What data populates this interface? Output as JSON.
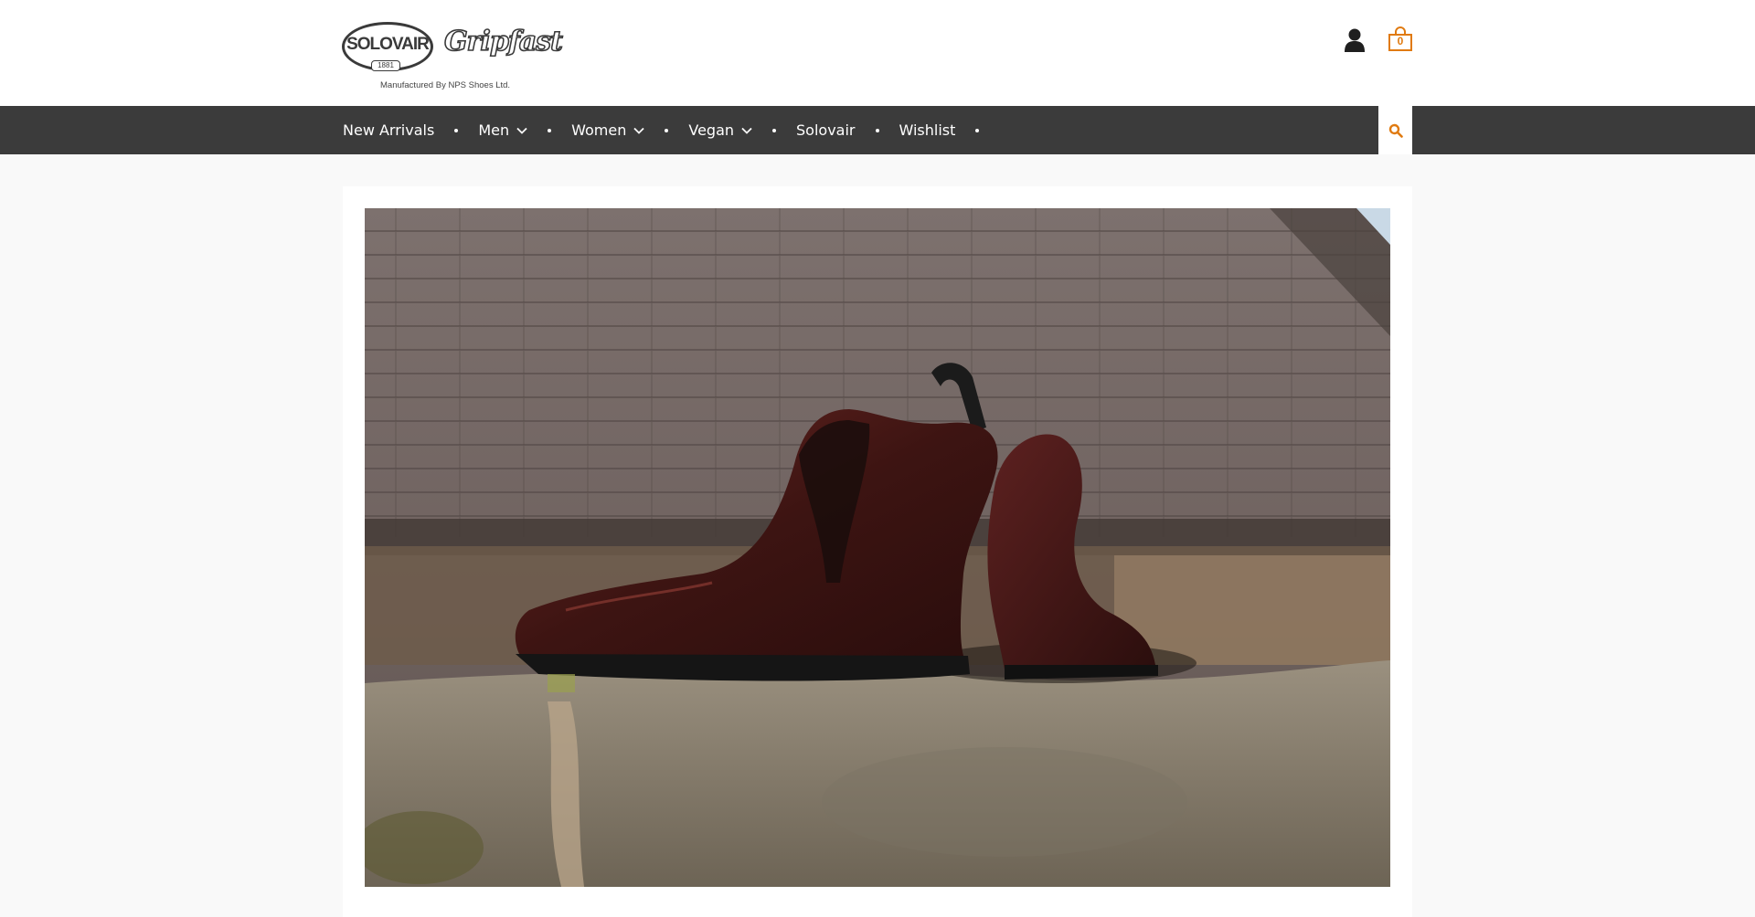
{
  "brand": {
    "logo_text": "SOLOVAIR",
    "logo_year": "1881",
    "script_text": "Gripfast",
    "tagline": "Manufactured By NPS Shoes Ltd."
  },
  "header": {
    "account_icon": "user-icon",
    "cart_icon": "shopping-bag-icon",
    "cart_count": "0",
    "accent_color": "#e07a10"
  },
  "nav": {
    "items": [
      {
        "label": "New Arrivals",
        "has_dropdown": false
      },
      {
        "label": "Men",
        "has_dropdown": true
      },
      {
        "label": "Women",
        "has_dropdown": true
      },
      {
        "label": "Vegan",
        "has_dropdown": true
      },
      {
        "label": "Solovair",
        "has_dropdown": false
      },
      {
        "label": "Wishlist",
        "has_dropdown": false
      }
    ],
    "search_icon": "search-icon",
    "background": "#3b3b3b"
  },
  "hero": {
    "image_subject": "oxblood leather chelsea boots on stone wall",
    "colors": {
      "roof": "#6f6461",
      "stone": "#8f8575",
      "boot": "#4a1a18"
    }
  }
}
